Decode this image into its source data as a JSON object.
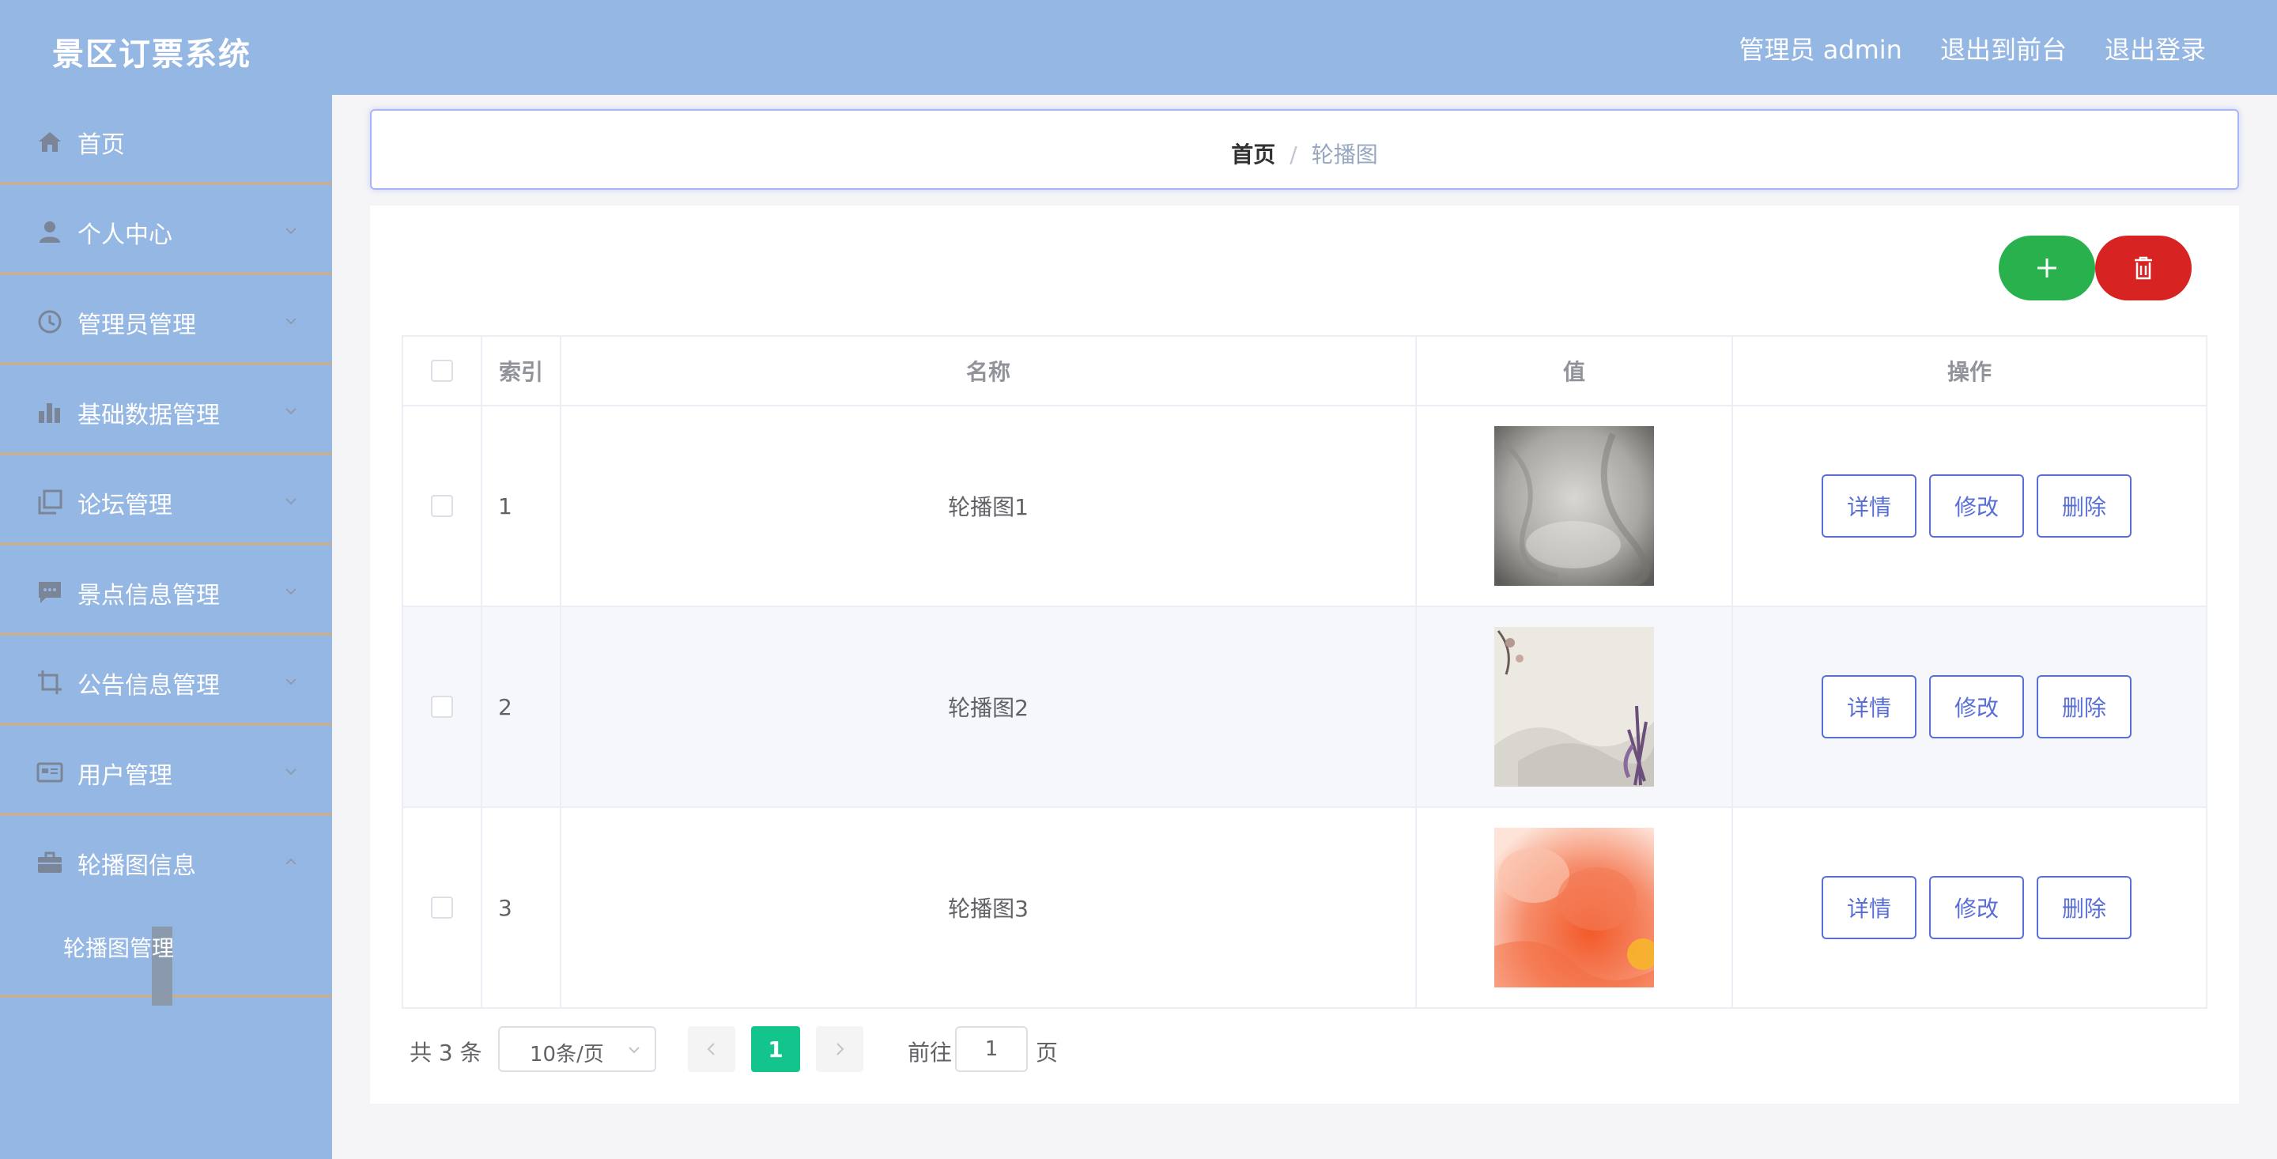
{
  "header": {
    "title": "景区订票系统",
    "links": [
      "管理员 admin",
      "退出到前台",
      "退出登录"
    ]
  },
  "sidebar": {
    "items": [
      {
        "label": "首页",
        "icon": "home-icon"
      },
      {
        "label": "个人中心",
        "icon": "user-icon"
      },
      {
        "label": "管理员管理",
        "icon": "clock-icon"
      },
      {
        "label": "基础数据管理",
        "icon": "bar-chart-icon"
      },
      {
        "label": "论坛管理",
        "icon": "copy-icon"
      },
      {
        "label": "景点信息管理",
        "icon": "chat-icon"
      },
      {
        "label": "公告信息管理",
        "icon": "crop-icon"
      },
      {
        "label": "用户管理",
        "icon": "card-icon"
      },
      {
        "label": "轮播图信息",
        "icon": "briefcase-icon"
      }
    ],
    "submenu": {
      "label": "轮播图管理"
    }
  },
  "breadcrumb": {
    "home": "首页",
    "separator": "/",
    "current": "轮播图"
  },
  "toolbar": {
    "add_icon": "plus-icon",
    "delete_icon": "trash-icon",
    "add_color": "#28b14c",
    "delete_color": "#d82323"
  },
  "table": {
    "columns": [
      "索引",
      "名称",
      "值",
      "操作"
    ],
    "rows": [
      {
        "index": "1",
        "name": "轮播图1",
        "image": "grey-texture"
      },
      {
        "index": "2",
        "name": "轮播图2",
        "image": "ink-flowers"
      },
      {
        "index": "3",
        "name": "轮播图3",
        "image": "orange-watercolor"
      }
    ],
    "actions": {
      "detail": "详情",
      "edit": "修改",
      "delete": "删除"
    }
  },
  "pagination": {
    "total": "共 3 条",
    "page_size": "10条/页",
    "current_page": "1",
    "goto_prefix": "前往",
    "goto_value": "1",
    "goto_suffix": "页",
    "active_color": "#13c48d"
  }
}
